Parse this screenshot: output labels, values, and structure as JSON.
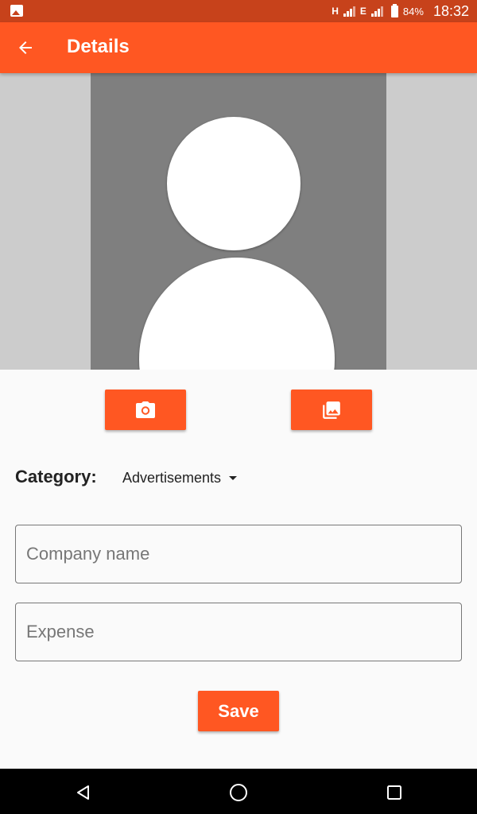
{
  "status_bar": {
    "left_icon": "image-notification-icon",
    "network_1": "H",
    "network_2": "E",
    "battery_percent": "84%",
    "time": "18:32"
  },
  "app_bar": {
    "back_icon": "arrow-back-icon",
    "title": "Details"
  },
  "photo": {
    "placeholder_icon": "person-silhouette-icon"
  },
  "photo_actions": {
    "camera_icon": "camera-icon",
    "gallery_icon": "photo-library-icon"
  },
  "category": {
    "label": "Category:",
    "selected": "Advertisements",
    "dropdown_icon": "arrow-drop-down-icon"
  },
  "form": {
    "company_placeholder": "Company name",
    "company_value": "",
    "expense_placeholder": "Expense",
    "expense_value": ""
  },
  "save_label": "Save",
  "nav_bar": {
    "back_icon": "nav-back-triangle-icon",
    "home_icon": "nav-home-circle-icon",
    "recents_icon": "nav-recents-square-icon"
  },
  "colors": {
    "primary": "#ff5722",
    "status_bar": "#c7421b",
    "photo_bg": "#7f7f7f",
    "photo_side": "#cccccc"
  }
}
